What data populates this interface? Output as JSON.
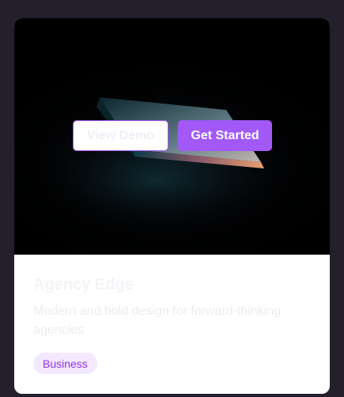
{
  "card": {
    "title": "Agency Edge",
    "description": "Modern and bold design for forward-thinking agencies",
    "tag": "Business"
  },
  "actions": {
    "view_demo": "View Demo",
    "get_started": "Get Started"
  },
  "colors": {
    "page_bg": "#231f2c",
    "accent": "#a259f7",
    "tag_bg": "#f3e8ff",
    "tag_text": "#9333ea"
  }
}
